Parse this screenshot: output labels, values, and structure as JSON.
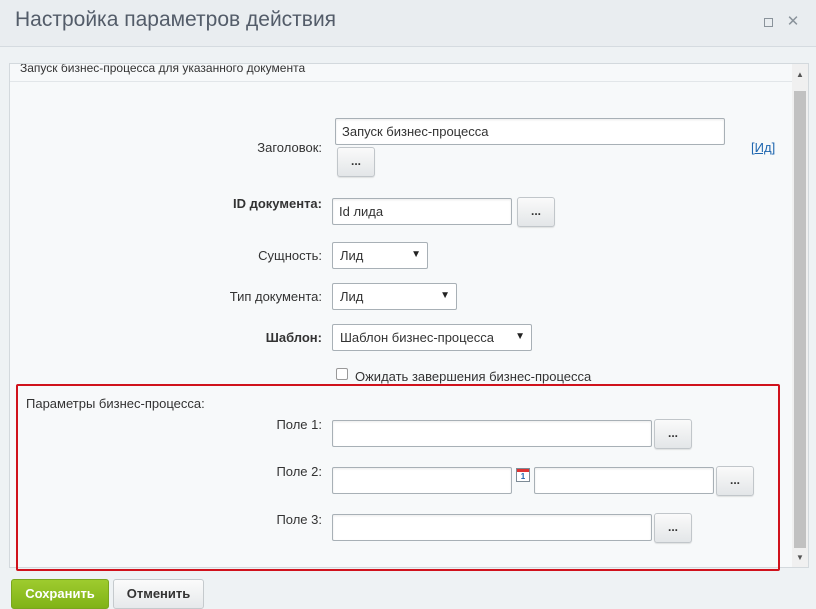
{
  "window": {
    "title": "Настройка параметров действия"
  },
  "panel": {
    "caption": "Запуск бизнес-процесса для указанного документа"
  },
  "form": {
    "title_label": "Заголовок:",
    "title_value": "Запуск бизнес-процесса",
    "dots": "...",
    "link_open": "[",
    "link_text": "Ид",
    "link_close": "]",
    "doc_id_label": "ID документа:",
    "doc_id_value": "Id лида",
    "entity_label": "Сущность:",
    "entity_value": "Лид",
    "doc_type_label": "Тип документа:",
    "doc_type_value": "Лид",
    "template_label": "Шаблон:",
    "template_value": "Шаблон бизнес-процесса",
    "wait_label": "Ожидать завершения бизнес-процесса",
    "wait_checked": false
  },
  "params": {
    "heading": "Параметры бизнес-процесса:",
    "field1_label": "Поле 1:",
    "field1_value": "",
    "field2_label": "Поле 2:",
    "field2_value_a": "",
    "field2_value_b": "",
    "calendar_num": "1",
    "field3_label": "Поле 3:",
    "field3_value": ""
  },
  "footer": {
    "save_label": "Сохранить",
    "cancel_label": "Отменить"
  },
  "colors": {
    "highlight_frame": "#d0121c",
    "save_button": "#8bbd1e",
    "link": "#2067b0"
  }
}
